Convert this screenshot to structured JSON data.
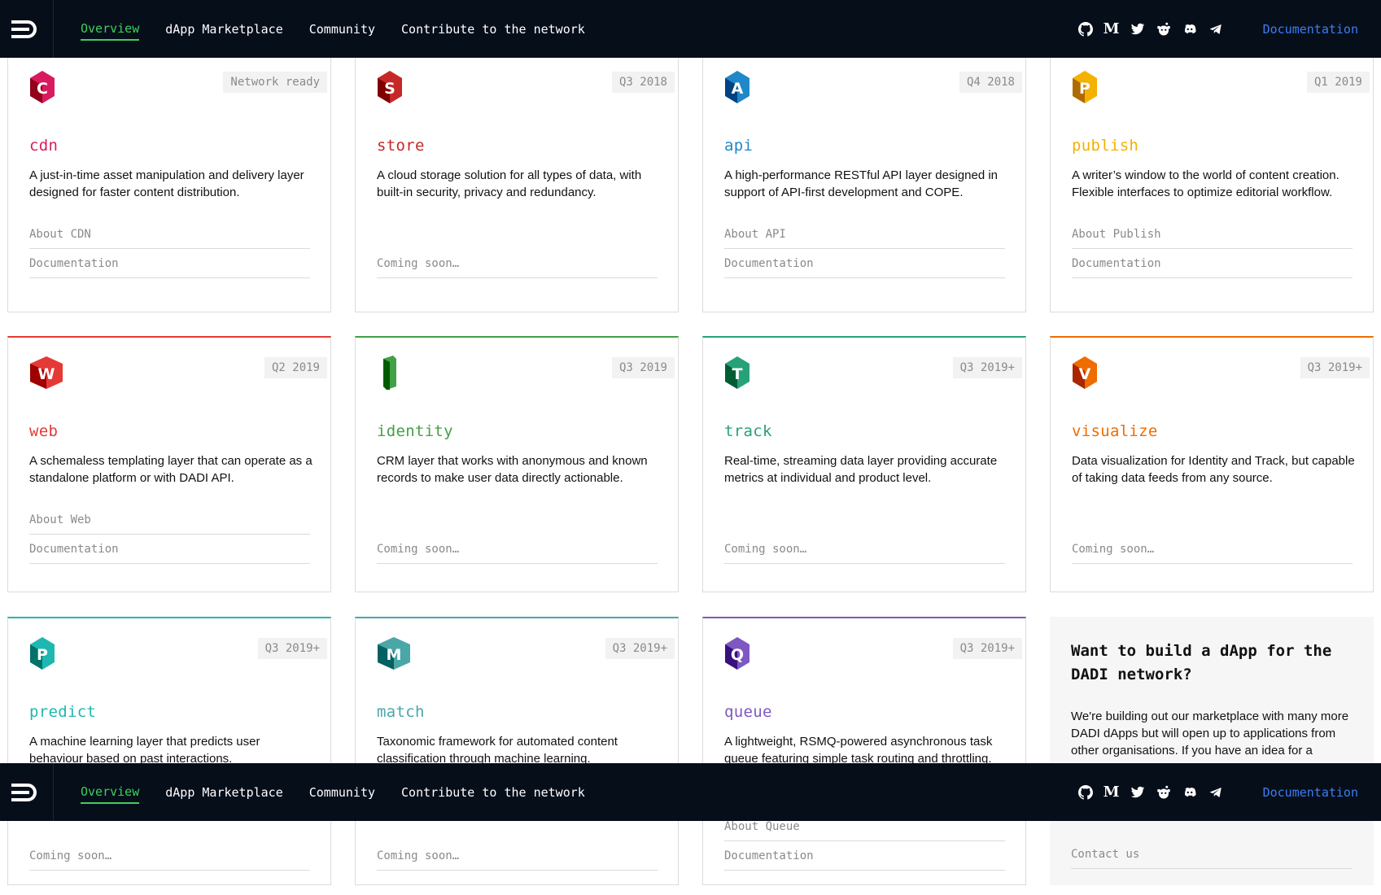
{
  "nav": {
    "links": [
      {
        "label": "Overview",
        "active": true
      },
      {
        "label": "dApp Marketplace",
        "active": false
      },
      {
        "label": "Community",
        "active": false
      },
      {
        "label": "Contribute to the network",
        "active": false
      }
    ],
    "social_icons": [
      "github-icon",
      "medium-icon",
      "twitter-icon",
      "reddit-icon",
      "discord-icon",
      "telegram-icon"
    ],
    "medium_glyph": "M",
    "docs_label": "Documentation",
    "colors": {
      "background": "#060e1a",
      "active": "#3ecf5e",
      "docs": "#3d7df0"
    }
  },
  "dapps": [
    {
      "id": "cdn",
      "name": "cdn",
      "badge": "Network ready",
      "desc": "A just-in-time asset manipulation and delivery layer designed for faster content distribution.",
      "link1": "About CDN",
      "link2": "Documentation",
      "color": "#d81b60",
      "letter": "C"
    },
    {
      "id": "store",
      "name": "store",
      "badge": "Q3 2018",
      "desc": "A cloud storage solution for all types of data, with built-in security, privacy and redundancy.",
      "link1": "",
      "link2": "Coming soon…",
      "color": "#c62828",
      "letter": "S"
    },
    {
      "id": "api",
      "name": "api",
      "badge": "Q4 2018",
      "desc": "A high-performance RESTful API layer designed in support of API-first development and COPE.",
      "link1": "About API",
      "link2": "Documentation",
      "color": "#1e88c8",
      "letter": "A"
    },
    {
      "id": "publish",
      "name": "publish",
      "badge": "Q1 2019",
      "desc": "A writer’s window to the world of content creation. Flexible interfaces to optimize editorial workflow.",
      "link1": "About Publish",
      "link2": "Documentation",
      "color": "#f5b100",
      "letter": "P"
    },
    {
      "id": "web",
      "name": "web",
      "badge": "Q2 2019",
      "desc": "A schemaless templating layer that can operate as a standalone platform or with DADI API.",
      "link1": "About Web",
      "link2": "Documentation",
      "color": "#e53935",
      "letter": "W"
    },
    {
      "id": "identity",
      "name": "identity",
      "badge": "Q3 2019",
      "desc": "CRM layer that works with anonymous and known records to make user data directly actionable.",
      "link1": "",
      "link2": "Coming soon…",
      "color": "#43a047",
      "letter": "i"
    },
    {
      "id": "track",
      "name": "track",
      "badge": "Q3 2019+",
      "desc": "Real-time, streaming data layer providing accurate metrics at individual and product level.",
      "link1": "",
      "link2": "Coming soon…",
      "color": "#26a27a",
      "letter": "T"
    },
    {
      "id": "visualize",
      "name": "visualize",
      "badge": "Q3 2019+",
      "desc": "Data visualization for Identity and Track, but capable of taking data feeds from any source.",
      "link1": "",
      "link2": "Coming soon…",
      "color": "#ef6c00",
      "letter": "V"
    },
    {
      "id": "predict",
      "name": "predict",
      "badge": "Q3 2019+",
      "desc": "A machine learning layer that predicts user behaviour based on past interactions.",
      "link1": "",
      "link2": "Coming soon…",
      "color": "#1fb8b0",
      "letter": "P"
    },
    {
      "id": "match",
      "name": "match",
      "badge": "Q3 2019+",
      "desc": "Taxonomic framework for automated content classification through machine learning.",
      "link1": "",
      "link2": "Coming soon…",
      "color": "#4aa7a8",
      "letter": "M"
    },
    {
      "id": "queue",
      "name": "queue",
      "badge": "Q3 2019+",
      "desc": "A lightweight, RSMQ-powered asynchronous task queue featuring simple task routing and throttling.",
      "link1": "About Queue",
      "link2": "Documentation",
      "color": "#7e57c2",
      "letter": "Q"
    }
  ],
  "cta": {
    "title": "Want to build a dApp for the DADI network?",
    "desc": "We're building out our marketplace with many more DADI dApps but will open up to applications from other organisations. If you have an idea for a",
    "link": "Contact us"
  }
}
